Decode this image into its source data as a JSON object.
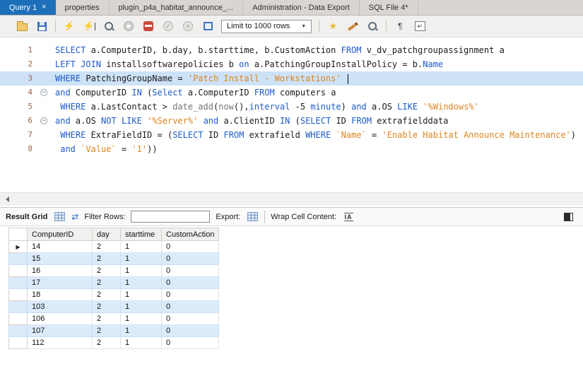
{
  "tabs": [
    {
      "label": "Query 1",
      "close": "×",
      "active": true
    },
    {
      "label": "properties",
      "active": false
    },
    {
      "label": "plugin_p4a_habitat_announce_...",
      "active": false
    },
    {
      "label": "Administration - Data Export",
      "active": false
    },
    {
      "label": "SQL File 4*",
      "active": false
    }
  ],
  "toolbar": {
    "limit_dropdown": "Limit to 1000 rows",
    "icons": [
      "open-file-icon",
      "save-icon",
      "execute-icon",
      "execute-current-icon",
      "explain-icon",
      "stop-icon",
      "stop-on-error-icon",
      "commit-icon",
      "rollback-icon",
      "autocommit-icon",
      "beautify-star-icon",
      "beautify-brush-icon",
      "find-icon",
      "invisible-chars-icon",
      "wrap-text-icon"
    ],
    "commit_glyph": "✓",
    "rollback_glyph": "×",
    "execute_glyph": "⚡",
    "caret_glyph": "▼",
    "star_glyph": "★",
    "pilcrow_glyph": "¶",
    "wrap_glyph": "↵",
    "refresh_glyph": "⇄",
    "fold_glyph": "−",
    "row_marker_glyph": "▶"
  },
  "editor": {
    "lines": [
      {
        "num": "1",
        "fold": false,
        "highlighted": false,
        "cursor": false,
        "segments": [
          {
            "t": "SELECT",
            "c": "k"
          },
          {
            "t": " a.ComputerID, b.day, b.starttime, b.CustomAction ",
            "c": "i"
          },
          {
            "t": "FROM",
            "c": "k"
          },
          {
            "t": " v_dv_patchgroupassignment a",
            "c": "i"
          }
        ]
      },
      {
        "num": "2",
        "fold": false,
        "highlighted": false,
        "cursor": false,
        "segments": [
          {
            "t": "LEFT JOIN",
            "c": "k"
          },
          {
            "t": " installsoftwarepolicies b ",
            "c": "i"
          },
          {
            "t": "on",
            "c": "k"
          },
          {
            "t": " a.PatchingGroupInstallPolicy = b.",
            "c": "i"
          },
          {
            "t": "Name",
            "c": "k"
          }
        ]
      },
      {
        "num": "3",
        "fold": false,
        "highlighted": true,
        "cursor": true,
        "segments": [
          {
            "t": "WHERE",
            "c": "k"
          },
          {
            "t": " PatchingGroupName = ",
            "c": "i"
          },
          {
            "t": "'Patch Install - Workstations'",
            "c": "s"
          },
          {
            "t": " ",
            "c": "i"
          }
        ]
      },
      {
        "num": "4",
        "fold": true,
        "highlighted": false,
        "cursor": false,
        "segments": [
          {
            "t": "and",
            "c": "k"
          },
          {
            "t": " ComputerID ",
            "c": "i"
          },
          {
            "t": "IN",
            "c": "k"
          },
          {
            "t": " (",
            "c": "i"
          },
          {
            "t": "Select",
            "c": "k"
          },
          {
            "t": " a.ComputerID ",
            "c": "i"
          },
          {
            "t": "FROM",
            "c": "k"
          },
          {
            "t": " computers a",
            "c": "i"
          }
        ]
      },
      {
        "num": "5",
        "fold": false,
        "highlighted": false,
        "cursor": false,
        "segments": [
          {
            "t": " ",
            "c": "i"
          },
          {
            "t": "WHERE",
            "c": "k"
          },
          {
            "t": " a.LastContact > ",
            "c": "i"
          },
          {
            "t": "date_add",
            "c": "f"
          },
          {
            "t": "(",
            "c": "i"
          },
          {
            "t": "now",
            "c": "f"
          },
          {
            "t": "(),",
            "c": "i"
          },
          {
            "t": "interval",
            "c": "k"
          },
          {
            "t": " -5 ",
            "c": "i"
          },
          {
            "t": "minute",
            "c": "k"
          },
          {
            "t": ") ",
            "c": "i"
          },
          {
            "t": "and",
            "c": "k"
          },
          {
            "t": " a.OS ",
            "c": "i"
          },
          {
            "t": "LIKE",
            "c": "k"
          },
          {
            "t": " ",
            "c": "i"
          },
          {
            "t": "'%Windows%'",
            "c": "s"
          }
        ]
      },
      {
        "num": "6",
        "fold": true,
        "highlighted": false,
        "cursor": false,
        "segments": [
          {
            "t": "and",
            "c": "k"
          },
          {
            "t": " a.OS ",
            "c": "i"
          },
          {
            "t": "NOT LIKE",
            "c": "k"
          },
          {
            "t": " ",
            "c": "i"
          },
          {
            "t": "'%Server%'",
            "c": "s"
          },
          {
            "t": " ",
            "c": "i"
          },
          {
            "t": "and",
            "c": "k"
          },
          {
            "t": " a.ClientID ",
            "c": "i"
          },
          {
            "t": "IN",
            "c": "k"
          },
          {
            "t": " (",
            "c": "i"
          },
          {
            "t": "SELECT",
            "c": "k"
          },
          {
            "t": " ID ",
            "c": "i"
          },
          {
            "t": "FROM",
            "c": "k"
          },
          {
            "t": " extrafielddata",
            "c": "i"
          }
        ]
      },
      {
        "num": "7",
        "fold": false,
        "highlighted": false,
        "cursor": false,
        "segments": [
          {
            "t": " ",
            "c": "i"
          },
          {
            "t": "WHERE",
            "c": "k"
          },
          {
            "t": " ExtraFieldID = (",
            "c": "i"
          },
          {
            "t": "SELECT",
            "c": "k"
          },
          {
            "t": " ID ",
            "c": "i"
          },
          {
            "t": "FROM",
            "c": "k"
          },
          {
            "t": " extrafield ",
            "c": "i"
          },
          {
            "t": "WHERE",
            "c": "k"
          },
          {
            "t": " ",
            "c": "i"
          },
          {
            "t": "`Name`",
            "c": "b"
          },
          {
            "t": " = ",
            "c": "i"
          },
          {
            "t": "'Enable Habitat Announce Maintenance'",
            "c": "s"
          },
          {
            "t": ")",
            "c": "i"
          }
        ]
      },
      {
        "num": "8",
        "fold": false,
        "highlighted": false,
        "cursor": false,
        "segments": [
          {
            "t": " ",
            "c": "i"
          },
          {
            "t": "and",
            "c": "k"
          },
          {
            "t": " ",
            "c": "i"
          },
          {
            "t": "`Value`",
            "c": "b"
          },
          {
            "t": " = ",
            "c": "i"
          },
          {
            "t": "'1'",
            "c": "s"
          },
          {
            "t": "))",
            "c": "i"
          }
        ]
      }
    ]
  },
  "result_toolbar": {
    "title": "Result Grid",
    "filter_label": "Filter Rows:",
    "filter_value": "",
    "export_label": "Export:",
    "wrap_label": "Wrap Cell Content:"
  },
  "result_grid": {
    "columns": [
      "ComputerID",
      "day",
      "starttime",
      "CustomAction"
    ],
    "rows": [
      [
        "14",
        "2",
        "1",
        "0"
      ],
      [
        "15",
        "2",
        "1",
        "0"
      ],
      [
        "16",
        "2",
        "1",
        "0"
      ],
      [
        "17",
        "2",
        "1",
        "0"
      ],
      [
        "18",
        "2",
        "1",
        "0"
      ],
      [
        "103",
        "2",
        "1",
        "0"
      ],
      [
        "106",
        "2",
        "1",
        "0"
      ],
      [
        "107",
        "2",
        "1",
        "0"
      ],
      [
        "112",
        "2",
        "1",
        "0"
      ]
    ],
    "selected_row_index": 0
  },
  "colors": {
    "keyword": "#1e5bc6",
    "identifier": "#1c1c1c",
    "string": "#dd8520",
    "function": "#767676",
    "active_tab": "#1d6fba",
    "line_highlight": "#cde2f7",
    "row_alt": "#dcebfa"
  }
}
